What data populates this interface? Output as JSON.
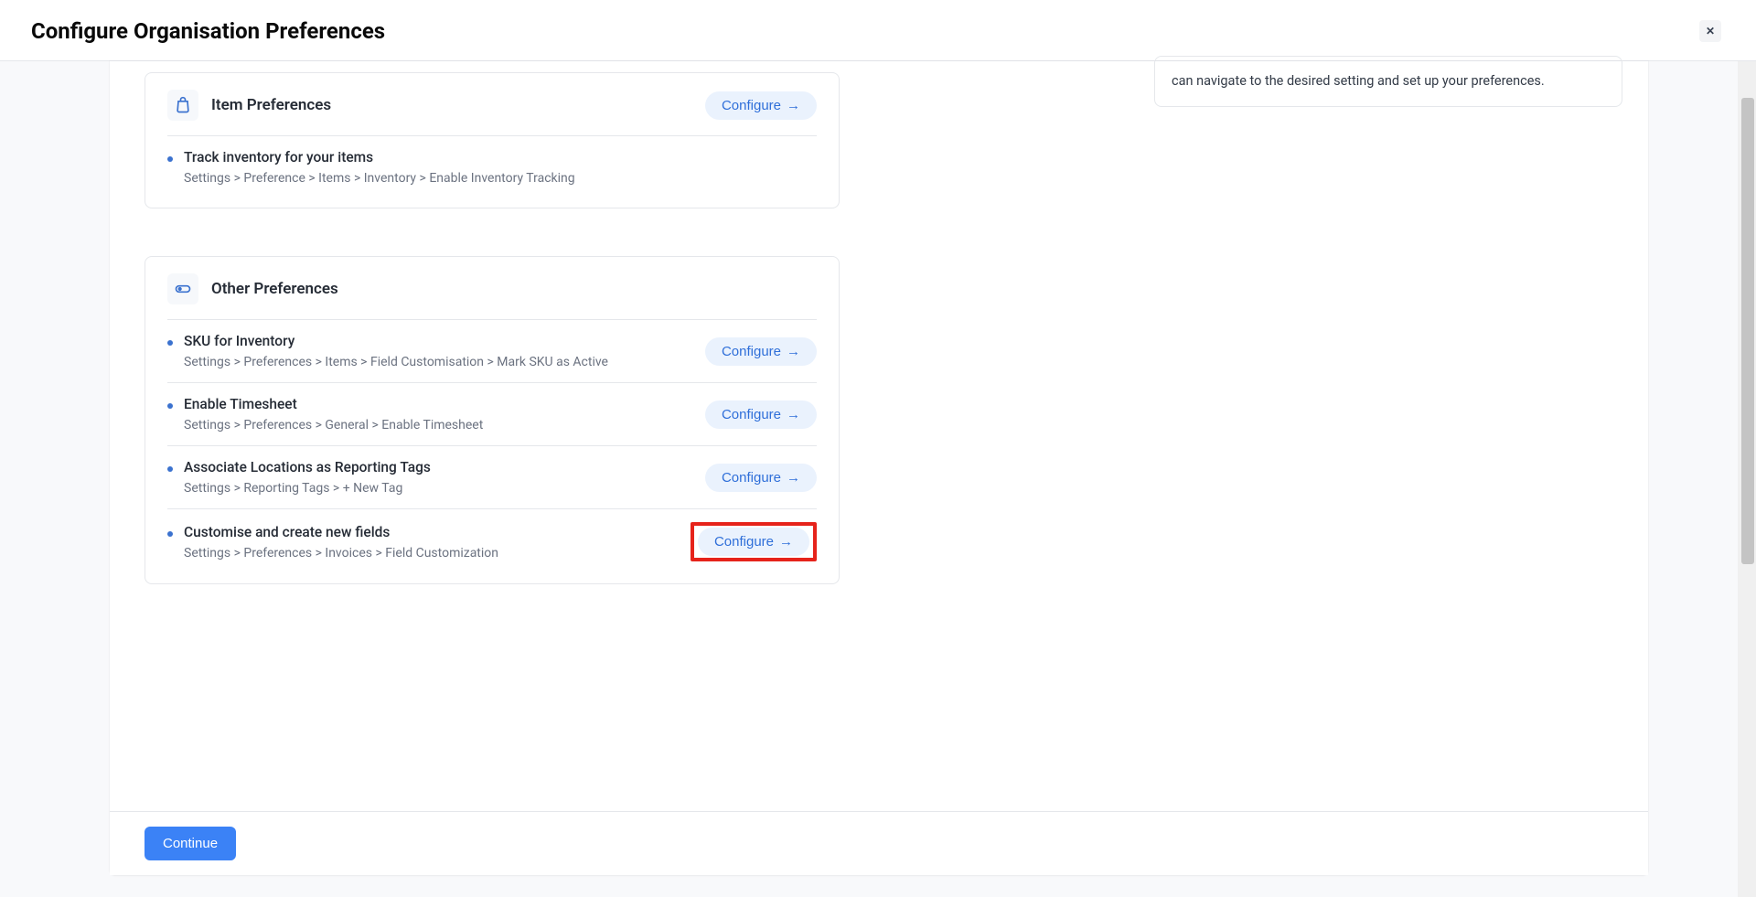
{
  "header": {
    "title": "Configure Organisation Preferences",
    "close": "✕"
  },
  "info": {
    "text": "can navigate to the desired setting and set up your preferences."
  },
  "card_item": {
    "title": "Item Preferences",
    "configure": "Configure",
    "items": [
      {
        "title": "Track inventory for your items",
        "path": "Settings > Preference > Items > Inventory > Enable Inventory Tracking"
      }
    ]
  },
  "card_other": {
    "title": "Other Preferences",
    "configure": "Configure",
    "items": [
      {
        "title": "SKU for Inventory",
        "path": "Settings > Preferences > Items > Field Customisation > Mark SKU as Active"
      },
      {
        "title": "Enable Timesheet",
        "path": "Settings > Preferences > General > Enable Timesheet"
      },
      {
        "title": "Associate Locations as Reporting Tags",
        "path": "Settings > Reporting Tags > + New Tag"
      },
      {
        "title": "Customise and create new fields",
        "path": "Settings > Preferences > Invoices > Field Customization"
      }
    ]
  },
  "footer": {
    "continue": "Continue"
  }
}
